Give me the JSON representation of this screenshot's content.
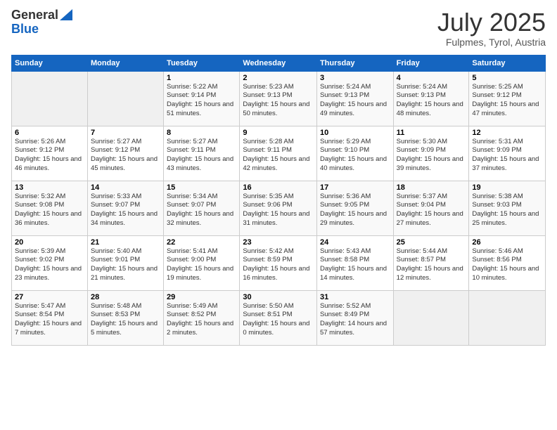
{
  "header": {
    "logo_general": "General",
    "logo_blue": "Blue",
    "title": "July 2025",
    "subtitle": "Fulpmes, Tyrol, Austria"
  },
  "weekdays": [
    "Sunday",
    "Monday",
    "Tuesday",
    "Wednesday",
    "Thursday",
    "Friday",
    "Saturday"
  ],
  "weeks": [
    [
      {
        "day": "",
        "sunrise": "",
        "sunset": "",
        "daylight": ""
      },
      {
        "day": "",
        "sunrise": "",
        "sunset": "",
        "daylight": ""
      },
      {
        "day": "1",
        "sunrise": "Sunrise: 5:22 AM",
        "sunset": "Sunset: 9:14 PM",
        "daylight": "Daylight: 15 hours and 51 minutes."
      },
      {
        "day": "2",
        "sunrise": "Sunrise: 5:23 AM",
        "sunset": "Sunset: 9:13 PM",
        "daylight": "Daylight: 15 hours and 50 minutes."
      },
      {
        "day": "3",
        "sunrise": "Sunrise: 5:24 AM",
        "sunset": "Sunset: 9:13 PM",
        "daylight": "Daylight: 15 hours and 49 minutes."
      },
      {
        "day": "4",
        "sunrise": "Sunrise: 5:24 AM",
        "sunset": "Sunset: 9:13 PM",
        "daylight": "Daylight: 15 hours and 48 minutes."
      },
      {
        "day": "5",
        "sunrise": "Sunrise: 5:25 AM",
        "sunset": "Sunset: 9:12 PM",
        "daylight": "Daylight: 15 hours and 47 minutes."
      }
    ],
    [
      {
        "day": "6",
        "sunrise": "Sunrise: 5:26 AM",
        "sunset": "Sunset: 9:12 PM",
        "daylight": "Daylight: 15 hours and 46 minutes."
      },
      {
        "day": "7",
        "sunrise": "Sunrise: 5:27 AM",
        "sunset": "Sunset: 9:12 PM",
        "daylight": "Daylight: 15 hours and 45 minutes."
      },
      {
        "day": "8",
        "sunrise": "Sunrise: 5:27 AM",
        "sunset": "Sunset: 9:11 PM",
        "daylight": "Daylight: 15 hours and 43 minutes."
      },
      {
        "day": "9",
        "sunrise": "Sunrise: 5:28 AM",
        "sunset": "Sunset: 9:11 PM",
        "daylight": "Daylight: 15 hours and 42 minutes."
      },
      {
        "day": "10",
        "sunrise": "Sunrise: 5:29 AM",
        "sunset": "Sunset: 9:10 PM",
        "daylight": "Daylight: 15 hours and 40 minutes."
      },
      {
        "day": "11",
        "sunrise": "Sunrise: 5:30 AM",
        "sunset": "Sunset: 9:09 PM",
        "daylight": "Daylight: 15 hours and 39 minutes."
      },
      {
        "day": "12",
        "sunrise": "Sunrise: 5:31 AM",
        "sunset": "Sunset: 9:09 PM",
        "daylight": "Daylight: 15 hours and 37 minutes."
      }
    ],
    [
      {
        "day": "13",
        "sunrise": "Sunrise: 5:32 AM",
        "sunset": "Sunset: 9:08 PM",
        "daylight": "Daylight: 15 hours and 36 minutes."
      },
      {
        "day": "14",
        "sunrise": "Sunrise: 5:33 AM",
        "sunset": "Sunset: 9:07 PM",
        "daylight": "Daylight: 15 hours and 34 minutes."
      },
      {
        "day": "15",
        "sunrise": "Sunrise: 5:34 AM",
        "sunset": "Sunset: 9:07 PM",
        "daylight": "Daylight: 15 hours and 32 minutes."
      },
      {
        "day": "16",
        "sunrise": "Sunrise: 5:35 AM",
        "sunset": "Sunset: 9:06 PM",
        "daylight": "Daylight: 15 hours and 31 minutes."
      },
      {
        "day": "17",
        "sunrise": "Sunrise: 5:36 AM",
        "sunset": "Sunset: 9:05 PM",
        "daylight": "Daylight: 15 hours and 29 minutes."
      },
      {
        "day": "18",
        "sunrise": "Sunrise: 5:37 AM",
        "sunset": "Sunset: 9:04 PM",
        "daylight": "Daylight: 15 hours and 27 minutes."
      },
      {
        "day": "19",
        "sunrise": "Sunrise: 5:38 AM",
        "sunset": "Sunset: 9:03 PM",
        "daylight": "Daylight: 15 hours and 25 minutes."
      }
    ],
    [
      {
        "day": "20",
        "sunrise": "Sunrise: 5:39 AM",
        "sunset": "Sunset: 9:02 PM",
        "daylight": "Daylight: 15 hours and 23 minutes."
      },
      {
        "day": "21",
        "sunrise": "Sunrise: 5:40 AM",
        "sunset": "Sunset: 9:01 PM",
        "daylight": "Daylight: 15 hours and 21 minutes."
      },
      {
        "day": "22",
        "sunrise": "Sunrise: 5:41 AM",
        "sunset": "Sunset: 9:00 PM",
        "daylight": "Daylight: 15 hours and 19 minutes."
      },
      {
        "day": "23",
        "sunrise": "Sunrise: 5:42 AM",
        "sunset": "Sunset: 8:59 PM",
        "daylight": "Daylight: 15 hours and 16 minutes."
      },
      {
        "day": "24",
        "sunrise": "Sunrise: 5:43 AM",
        "sunset": "Sunset: 8:58 PM",
        "daylight": "Daylight: 15 hours and 14 minutes."
      },
      {
        "day": "25",
        "sunrise": "Sunrise: 5:44 AM",
        "sunset": "Sunset: 8:57 PM",
        "daylight": "Daylight: 15 hours and 12 minutes."
      },
      {
        "day": "26",
        "sunrise": "Sunrise: 5:46 AM",
        "sunset": "Sunset: 8:56 PM",
        "daylight": "Daylight: 15 hours and 10 minutes."
      }
    ],
    [
      {
        "day": "27",
        "sunrise": "Sunrise: 5:47 AM",
        "sunset": "Sunset: 8:54 PM",
        "daylight": "Daylight: 15 hours and 7 minutes."
      },
      {
        "day": "28",
        "sunrise": "Sunrise: 5:48 AM",
        "sunset": "Sunset: 8:53 PM",
        "daylight": "Daylight: 15 hours and 5 minutes."
      },
      {
        "day": "29",
        "sunrise": "Sunrise: 5:49 AM",
        "sunset": "Sunset: 8:52 PM",
        "daylight": "Daylight: 15 hours and 2 minutes."
      },
      {
        "day": "30",
        "sunrise": "Sunrise: 5:50 AM",
        "sunset": "Sunset: 8:51 PM",
        "daylight": "Daylight: 15 hours and 0 minutes."
      },
      {
        "day": "31",
        "sunrise": "Sunrise: 5:52 AM",
        "sunset": "Sunset: 8:49 PM",
        "daylight": "Daylight: 14 hours and 57 minutes."
      },
      {
        "day": "",
        "sunrise": "",
        "sunset": "",
        "daylight": ""
      },
      {
        "day": "",
        "sunrise": "",
        "sunset": "",
        "daylight": ""
      }
    ]
  ]
}
